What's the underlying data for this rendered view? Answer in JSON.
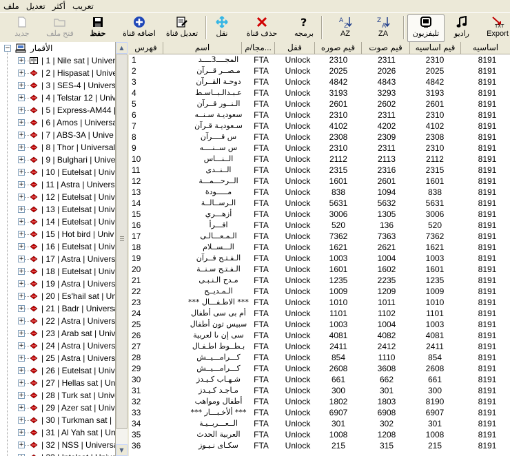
{
  "menu": [
    "ملف",
    "تعديل",
    "أكثر",
    "تعريب"
  ],
  "toolbar": {
    "buttons": [
      {
        "label": "Export",
        "icon": "export-txt-icon"
      },
      {
        "label": "راديو",
        "icon": "music-note-icon"
      },
      {
        "label": "تليفزيون",
        "icon": "tv-icon"
      },
      {
        "label": "ZA",
        "icon": "sort-za-icon"
      },
      {
        "label": "AZ",
        "icon": "sort-az-icon"
      },
      {
        "label": "برمجه",
        "icon": "question-icon"
      },
      {
        "label": "حذف قناة",
        "icon": "delete-x-icon"
      },
      {
        "label": "نقل",
        "icon": "move-arrows-icon"
      },
      {
        "label": "تعديل قناة",
        "icon": "edit-channel-icon"
      },
      {
        "label": "اضافه قناة",
        "icon": "add-plus-icon"
      },
      {
        "label": "حفظ",
        "icon": "save-disk-icon"
      },
      {
        "label": "فتح ملف",
        "icon": "open-folder-icon"
      },
      {
        "label": "جديد",
        "icon": "new-file-icon"
      }
    ]
  },
  "tree": {
    "root": "الأقمار",
    "items": [
      "| 1 | Nile sat | Univer",
      "| 2 | Hispasat | Unive",
      "| 3 | SES-4 | Universa",
      "| 4 | Telstar 12 | Univ",
      "| 5 | Express-AM44 |",
      "| 6 | Amos | Universal",
      "| 7 | ABS-3A | Unive",
      "| 8 | Thor | Universal",
      "| 9 | Bulghari | Unive",
      "| 10 | Eutelsat | Unive",
      "| 11 | Astra | Universa",
      "| 12 | Eutelsat | Unive",
      "| 13 | Eutelsat | Unive",
      "| 14 | Eutelsat | Unive",
      "| 15 | Hot bird | Univ",
      "| 16 | Eutelsat | Unive",
      "| 17 | Astra | Universa",
      "| 18 | Eutelsat | Unive",
      "| 19 | Astra | Universa",
      "| 20 | Es'hail sat | Uni",
      "| 21 | Badr | Universal",
      "| 22 | Astra | Universa",
      "| 23 | Arab sat | Univ",
      "| 24 | Astra | Universa",
      "| 25 | Astra | Universa",
      "| 26 | Eutelsat | Unive",
      "| 27 | Hellas sat | Uni",
      "| 28 | Turk sat | Unive",
      "| 29 | Azer sat | Unive",
      "| 30 | Turkman sat |",
      "| 31 | Al Yah sat | Un",
      "| 32 | NSS | Universal",
      "| 33 | Intelsat | Unive"
    ]
  },
  "grid": {
    "headers": [
      "فهرس",
      "اسم",
      "مجا/م...",
      "قفل",
      "قيم صوره",
      "قيم صوت",
      "قيم اساسيه",
      "اساسيه"
    ],
    "rows": [
      [
        "1",
        "المجــــ3ــــد",
        "FTA",
        "Unlock",
        "2310",
        "2311",
        "2310",
        "8191"
      ],
      [
        "2",
        "مـصــر قــرآن",
        "FTA",
        "Unlock",
        "2025",
        "2026",
        "2025",
        "8191"
      ],
      [
        "3",
        "دوحـة القــرآن",
        "FTA",
        "Unlock",
        "4842",
        "4843",
        "4842",
        "8191"
      ],
      [
        "4",
        "عـبـدالـبــاسـط",
        "FTA",
        "Unlock",
        "3193",
        "3293",
        "3193",
        "8191"
      ],
      [
        "5",
        "الـنــور قــرآن",
        "FTA",
        "Unlock",
        "2601",
        "2602",
        "2601",
        "8191"
      ],
      [
        "6",
        "سعوديـة سـنــه",
        "FTA",
        "Unlock",
        "2310",
        "2311",
        "2310",
        "8191"
      ],
      [
        "7",
        "سـعوديـة قـرآن",
        "FTA",
        "Unlock",
        "4102",
        "4202",
        "4102",
        "8191"
      ],
      [
        "8",
        "س قــــرآن",
        "FTA",
        "Unlock",
        "2308",
        "2309",
        "2308",
        "8191"
      ],
      [
        "9",
        "س ســنــــه",
        "FTA",
        "Unlock",
        "2310",
        "2311",
        "2310",
        "8191"
      ],
      [
        "10",
        "الــنـــاس",
        "FTA",
        "Unlock",
        "2112",
        "2113",
        "2112",
        "8191"
      ],
      [
        "11",
        "الــنــدى",
        "FTA",
        "Unlock",
        "2315",
        "2316",
        "2315",
        "8191"
      ],
      [
        "12",
        "الــرحـــمـــة",
        "FTA",
        "Unlock",
        "1601",
        "2601",
        "1601",
        "8191"
      ],
      [
        "13",
        "مـــــودة",
        "FTA",
        "Unlock",
        "838",
        "1094",
        "838",
        "8191"
      ],
      [
        "14",
        "الـرســالــة",
        "FTA",
        "Unlock",
        "5631",
        "5632",
        "5631",
        "8191"
      ],
      [
        "15",
        "أزهـــري",
        "FTA",
        "Unlock",
        "3006",
        "1305",
        "3006",
        "8191"
      ],
      [
        "16",
        "اقـــرأ",
        "FTA",
        "Unlock",
        "520",
        "136",
        "520",
        "8191"
      ],
      [
        "17",
        "الـمـعـــالـى",
        "FTA",
        "Unlock",
        "7362",
        "7363",
        "7362",
        "8191"
      ],
      [
        "18",
        "الـــســلام",
        "FTA",
        "Unlock",
        "1621",
        "2621",
        "1621",
        "8191"
      ],
      [
        "19",
        "الـفـتـح قــرآن",
        "FTA",
        "Unlock",
        "1003",
        "1004",
        "1003",
        "8191"
      ],
      [
        "20",
        "الـفـتـح سـنــة",
        "FTA",
        "Unlock",
        "1601",
        "1602",
        "1601",
        "8191"
      ],
      [
        "21",
        "مـدح الـنـبـى",
        "FTA",
        "Unlock",
        "1235",
        "2235",
        "1235",
        "8191"
      ],
      [
        "22",
        "الـمـديــح",
        "FTA",
        "Unlock",
        "1009",
        "1209",
        "1009",
        "8191"
      ],
      [
        "23",
        "*** الاطـفـــال ***",
        "FTA",
        "Unlock",
        "1010",
        "1011",
        "1010",
        "8191"
      ],
      [
        "24",
        "أم بى سى أطفال",
        "FTA",
        "Unlock",
        "1101",
        "1102",
        "1101",
        "8191"
      ],
      [
        "25",
        "سبيس تون أطفال",
        "FTA",
        "Unlock",
        "1003",
        "1004",
        "1003",
        "8191"
      ],
      [
        "26",
        "سى إن ىا لعربية",
        "FTA",
        "Unlock",
        "4081",
        "4082",
        "4081",
        "8191"
      ],
      [
        "27",
        "بـطــوط اطـفـال",
        "FTA",
        "Unlock",
        "2411",
        "2412",
        "2411",
        "8191"
      ],
      [
        "28",
        "كـــرامـــيــش",
        "FTA",
        "Unlock",
        "854",
        "1110",
        "854",
        "8191"
      ],
      [
        "29",
        "كـــرامـــيــش",
        "FTA",
        "Unlock",
        "2608",
        "3608",
        "2608",
        "8191"
      ],
      [
        "30",
        "شـهـاب كـيـدز",
        "FTA",
        "Unlock",
        "661",
        "662",
        "661",
        "8191"
      ],
      [
        "31",
        "مـاجـد كـيـدز",
        "FTA",
        "Unlock",
        "300",
        "301",
        "300",
        "8191"
      ],
      [
        "32",
        "أطفال ومواهب",
        "FTA",
        "Unlock",
        "1802",
        "1803",
        "8190",
        "8191"
      ],
      [
        "33",
        "*** ألأخـبـــار ***",
        "FTA",
        "Unlock",
        "6907",
        "6908",
        "6907",
        "8191"
      ],
      [
        "34",
        "الــعـــربــيـة",
        "FTA",
        "Unlock",
        "301",
        "302",
        "301",
        "8191"
      ],
      [
        "35",
        "العربية الحدث",
        "FTA",
        "Unlock",
        "1008",
        "1208",
        "1008",
        "8191"
      ],
      [
        "36",
        "سكـاى نـيـوز",
        "FTA",
        "Unlock",
        "215",
        "315",
        "215",
        "8191"
      ]
    ]
  }
}
